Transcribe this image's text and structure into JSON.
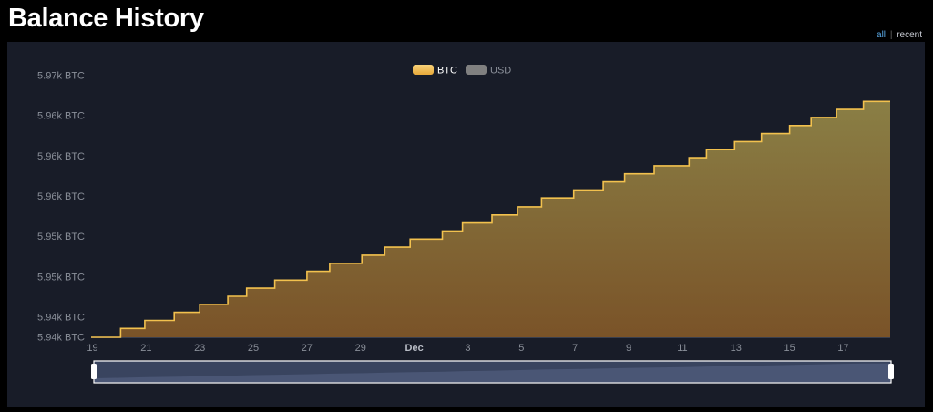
{
  "header": {
    "title": "Balance History",
    "toggle": {
      "all_label": "all",
      "separator": "|",
      "recent_label": "recent"
    }
  },
  "colors": {
    "btc_line": "#f2c14e",
    "btc_fill_top": "#8a7f45",
    "btc_fill_bottom": "#7a5328",
    "usd_swatch": "#808080",
    "panel_bg": "#181c28",
    "text_muted": "#8a8f99",
    "navigator_fill": "#4a5675"
  },
  "chart_data": {
    "type": "area",
    "step": true,
    "legend": [
      {
        "name": "BTC",
        "active": true
      },
      {
        "name": "USD",
        "active": false
      }
    ],
    "legend_position": "top-center",
    "y_ticks": [
      {
        "value": 5942.0,
        "label": "5.94k BTC"
      },
      {
        "value": 5944.5,
        "label": "5.94k BTC"
      },
      {
        "value": 5949.5,
        "label": "5.95k BTC"
      },
      {
        "value": 5954.5,
        "label": "5.95k BTC"
      },
      {
        "value": 5959.5,
        "label": "5.96k BTC"
      },
      {
        "value": 5964.5,
        "label": "5.96k BTC"
      },
      {
        "value": 5969.5,
        "label": "5.96k BTC"
      },
      {
        "value": 5974.5,
        "label": "5.97k BTC"
      }
    ],
    "ylim": [
      5942.0,
      5974.5
    ],
    "x_ticks": [
      {
        "day": 0,
        "label": "19",
        "bold": false
      },
      {
        "day": 2,
        "label": "21",
        "bold": false
      },
      {
        "day": 4,
        "label": "23",
        "bold": false
      },
      {
        "day": 6,
        "label": "25",
        "bold": false
      },
      {
        "day": 8,
        "label": "27",
        "bold": false
      },
      {
        "day": 10,
        "label": "29",
        "bold": false
      },
      {
        "day": 12,
        "label": "Dec",
        "bold": true
      },
      {
        "day": 14,
        "label": "3",
        "bold": false
      },
      {
        "day": 16,
        "label": "5",
        "bold": false
      },
      {
        "day": 18,
        "label": "7",
        "bold": false
      },
      {
        "day": 20,
        "label": "9",
        "bold": false
      },
      {
        "day": 22,
        "label": "11",
        "bold": false
      },
      {
        "day": 24,
        "label": "13",
        "bold": false
      },
      {
        "day": 26,
        "label": "15",
        "bold": false
      },
      {
        "day": 28,
        "label": "17",
        "bold": false
      }
    ],
    "xlim": [
      -0.05,
      29.75
    ],
    "series": [
      {
        "name": "BTC",
        "points": [
          {
            "day": -0.05,
            "value": 5942.0
          },
          {
            "day": 1.05,
            "value": 5943.1
          },
          {
            "day": 1.95,
            "value": 5944.1
          },
          {
            "day": 3.05,
            "value": 5945.1
          },
          {
            "day": 4.0,
            "value": 5946.1
          },
          {
            "day": 5.05,
            "value": 5947.1
          },
          {
            "day": 5.75,
            "value": 5948.1
          },
          {
            "day": 6.8,
            "value": 5949.1
          },
          {
            "day": 8.0,
            "value": 5950.2
          },
          {
            "day": 8.85,
            "value": 5951.2
          },
          {
            "day": 10.05,
            "value": 5952.2
          },
          {
            "day": 10.9,
            "value": 5953.2
          },
          {
            "day": 11.85,
            "value": 5954.2
          },
          {
            "day": 13.05,
            "value": 5955.2
          },
          {
            "day": 13.8,
            "value": 5956.2
          },
          {
            "day": 14.9,
            "value": 5957.2
          },
          {
            "day": 15.85,
            "value": 5958.2
          },
          {
            "day": 16.75,
            "value": 5959.3
          },
          {
            "day": 17.95,
            "value": 5960.3
          },
          {
            "day": 19.05,
            "value": 5961.3
          },
          {
            "day": 19.85,
            "value": 5962.3
          },
          {
            "day": 20.95,
            "value": 5963.3
          },
          {
            "day": 22.25,
            "value": 5964.3
          },
          {
            "day": 22.9,
            "value": 5965.3
          },
          {
            "day": 23.95,
            "value": 5966.3
          },
          {
            "day": 24.95,
            "value": 5967.3
          },
          {
            "day": 26.0,
            "value": 5968.3
          },
          {
            "day": 26.8,
            "value": 5969.3
          },
          {
            "day": 27.75,
            "value": 5970.3
          },
          {
            "day": 28.75,
            "value": 5971.3
          },
          {
            "day": 29.75,
            "value": 5971.3
          }
        ]
      }
    ]
  }
}
